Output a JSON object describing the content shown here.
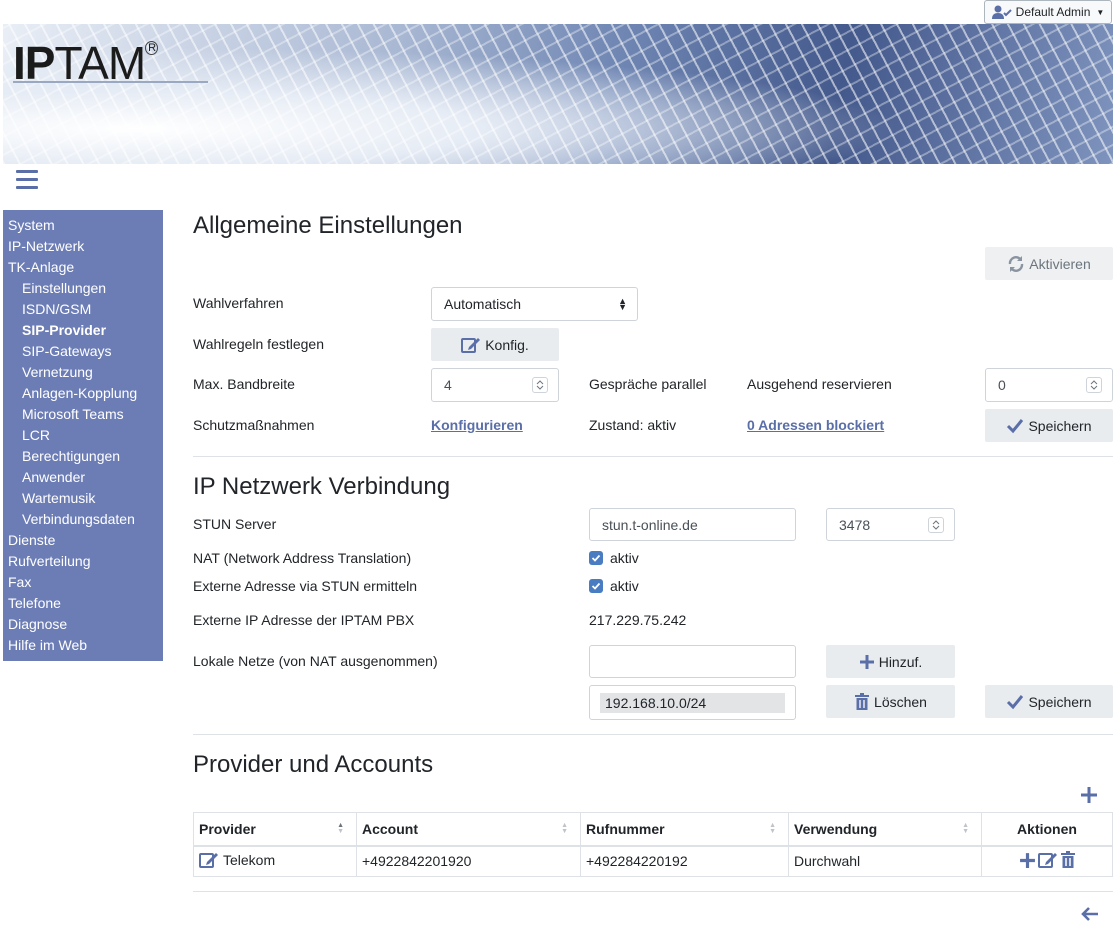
{
  "user": {
    "name": "Default Admin"
  },
  "banner": {
    "logo_bold": "IP",
    "logo_light": "TAM",
    "logo_mark": "R"
  },
  "sidebar": {
    "items": [
      {
        "label": "System",
        "level": 0
      },
      {
        "label": "IP-Netzwerk",
        "level": 0
      },
      {
        "label": "TK-Anlage",
        "level": 0
      },
      {
        "label": "Einstellungen",
        "level": 1
      },
      {
        "label": "ISDN/GSM",
        "level": 1
      },
      {
        "label": "SIP-Provider",
        "level": 1,
        "active": true
      },
      {
        "label": "SIP-Gateways",
        "level": 1
      },
      {
        "label": "Vernetzung",
        "level": 1
      },
      {
        "label": "Anlagen-Kopplung",
        "level": 1
      },
      {
        "label": "Microsoft Teams",
        "level": 1
      },
      {
        "label": "LCR",
        "level": 1
      },
      {
        "label": "Berechtigungen",
        "level": 1
      },
      {
        "label": "Anwender",
        "level": 1
      },
      {
        "label": "Wartemusik",
        "level": 1
      },
      {
        "label": "Verbindungsdaten",
        "level": 1
      },
      {
        "label": "Dienste",
        "level": 0
      },
      {
        "label": "Rufverteilung",
        "level": 0
      },
      {
        "label": "Fax",
        "level": 0
      },
      {
        "label": "Telefone",
        "level": 0
      },
      {
        "label": "Diagnose",
        "level": 0
      },
      {
        "label": "Hilfe im Web",
        "level": 0
      }
    ]
  },
  "general": {
    "title": "Allgemeine Einstellungen",
    "activate_label": "Aktivieren",
    "dial_method_label": "Wahlverfahren",
    "dial_method_value": "Automatisch",
    "dial_rules_label": "Wahlregeln festlegen",
    "config_button": "Konfig.",
    "bandwidth_label": "Max. Bandbreite",
    "bandwidth_value": "4",
    "calls_parallel_label": "Gespräche parallel",
    "outgoing_reserve_label": "Ausgehend reservieren",
    "outgoing_reserve_value": "0",
    "protection_label": "Schutzmaßnahmen",
    "configure_link": "Konfigurieren",
    "state_text": "Zustand: aktiv",
    "blocked_link": "0 Adressen blockiert",
    "save_label": "Speichern"
  },
  "network": {
    "title": "IP Netzwerk Verbindung",
    "stun_label": "STUN Server",
    "stun_server": "stun.t-online.de",
    "stun_port": "3478",
    "nat_label": "NAT (Network Address Translation)",
    "nat_checkbox": "aktiv",
    "ext_stun_label": "Externe Adresse via STUN ermitteln",
    "ext_stun_checkbox": "aktiv",
    "ext_ip_label": "Externe IP Adresse der IPTAM PBX",
    "ext_ip_value": "217.229.75.242",
    "local_nets_label": "Lokale Netze (von NAT ausgenommen)",
    "local_net_input": "",
    "add_label": "Hinzuf.",
    "local_net_entry": "192.168.10.0/24",
    "delete_label": "Löschen",
    "save_label": "Speichern"
  },
  "providers": {
    "title": "Provider und Accounts",
    "columns": [
      "Provider",
      "Account",
      "Rufnummer",
      "Verwendung",
      "Aktionen"
    ],
    "rows": [
      {
        "provider": "Telekom",
        "account": "+4922842201920",
        "number": "+492284220192",
        "usage": "Durchwahl"
      }
    ]
  },
  "colors": {
    "sidebar": "#6c7db5",
    "accent": "#5a6fa8",
    "checkbox": "#4a7cc2"
  },
  "icons": [
    "user-icon",
    "hamburger-icon",
    "refresh-icon",
    "edit-icon",
    "check-icon",
    "plus-icon",
    "trash-icon",
    "arrow-left-icon"
  ]
}
